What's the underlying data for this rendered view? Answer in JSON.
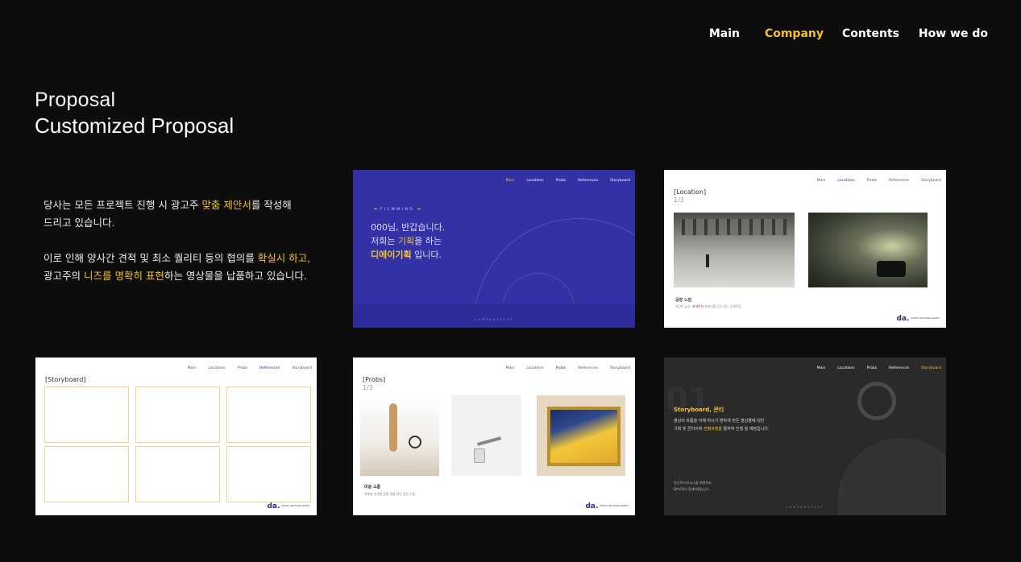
{
  "nav": {
    "items": [
      {
        "label": "Main",
        "active": false
      },
      {
        "label": "Company",
        "active": true
      },
      {
        "label": "Contents",
        "active": false
      },
      {
        "label": "How we do",
        "active": false
      }
    ]
  },
  "heading": {
    "line1": "Proposal",
    "line2": "Customized Proposal"
  },
  "description": {
    "p1_a": "당사는 모든 프로젝트 진행 시  광고주 ",
    "p1_hl": "맞춤 제안서",
    "p1_b": "를 작성해",
    "p1_c": "드리고 있습니다",
    "p1_dot": ".",
    "p2_a": "이로 인해 양사간 견적 및 최소 퀄리티 등의 협의를 ",
    "p2_hl1": "확실시 하고,",
    "p2_b": "광고주의 ",
    "p2_hl2": "니즈를 명확히 표현",
    "p2_c": "하는 영상물을 납품하고 있습니다."
  },
  "mini_nav": [
    "Main",
    "Locations",
    "Probs",
    "References",
    "Storyboard"
  ],
  "cards": {
    "c1": {
      "filming": "FILMMING",
      "greet1": "000님, 반갑습니다.",
      "greet2a": "저희는 ",
      "greet2hl": "기획",
      "greet2b": "을 하는",
      "greet3hl": "디에이기획",
      "greet3b": " 입니다.",
      "copy": "COMPANYTEST"
    },
    "c2": {
      "section": "[Location]",
      "page": "1/3",
      "caption": "공장 느낌",
      "caption_a": "천장이 높고, ",
      "caption_r": "회색톤의",
      "caption_b": " 분위기를 갖고 있는 공계작업"
    },
    "c3": {
      "section": "[Storyboard]"
    },
    "c4": {
      "section": "[Probs]",
      "page": "1/3",
      "caption": "미술 소품",
      "caption2": "액체형 데색형 참형 정물 관련 참된 소품"
    },
    "c5": {
      "big": "01",
      "title": "Storyboard, 콘티",
      "desc_a": "영상의 흐름을 이해 하시기 편하게 만든 영상물에 대한",
      "desc_b": "기획 및 콘티이며 ",
      "desc_hl": "컨펌과정을",
      "desc_c": " 통하여 진행 될 예정입니다.",
      "foot1": "당신의 비즈니스를 위엔까지,",
      "foot2": "DA기획이 함께하겠습니다.",
      "copy": "COMPANYTEST"
    }
  },
  "logo": "da.",
  "logo_small": "DIGITAL ARCHIVING AGENCY",
  "colors": {
    "accent": "#f2c12e",
    "background": "#0d0d0e",
    "blue_card": "#3331a6",
    "brand": "#2d2e85"
  }
}
